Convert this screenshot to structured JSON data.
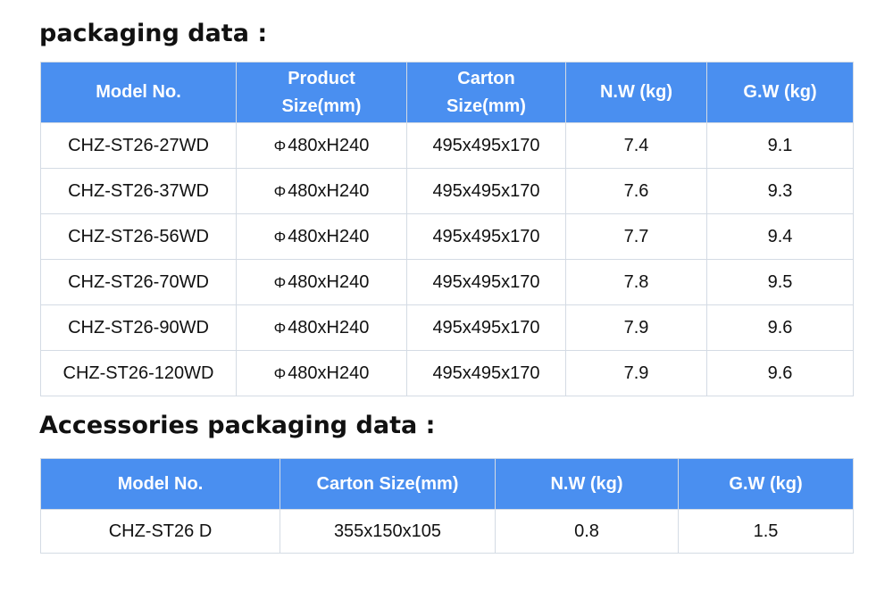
{
  "section1": {
    "title": "packaging data :",
    "headers": [
      {
        "line1": "Model No.",
        "line2": ""
      },
      {
        "line1": "Product",
        "line2": "Size(mm)"
      },
      {
        "line1": "Carton",
        "line2": "Size(mm)"
      },
      {
        "line1": "N.W (kg)",
        "line2": ""
      },
      {
        "line1": "G.W (kg)",
        "line2": ""
      }
    ],
    "rows": [
      {
        "model": "CHZ-ST26-27WD",
        "phi": "Φ",
        "size": "480xH240",
        "carton": "495x495x170",
        "nw": "7.4",
        "gw": "9.1"
      },
      {
        "model": "CHZ-ST26-37WD",
        "phi": "Φ",
        "size": "480xH240",
        "carton": "495x495x170",
        "nw": "7.6",
        "gw": "9.3"
      },
      {
        "model": "CHZ-ST26-56WD",
        "phi": "Φ",
        "size": "480xH240",
        "carton": "495x495x170",
        "nw": "7.7",
        "gw": "9.4"
      },
      {
        "model": "CHZ-ST26-70WD",
        "phi": "Φ",
        "size": "480xH240",
        "carton": "495x495x170",
        "nw": "7.8",
        "gw": "9.5"
      },
      {
        "model": "CHZ-ST26-90WD",
        "phi": "Φ",
        "size": "480xH240",
        "carton": "495x495x170",
        "nw": "7.9",
        "gw": "9.6"
      },
      {
        "model": "CHZ-ST26-120WD",
        "phi": "Φ",
        "size": "480xH240",
        "carton": "495x495x170",
        "nw": "7.9",
        "gw": "9.6"
      }
    ]
  },
  "section2": {
    "title": "Accessories packaging data :",
    "headers": [
      "Model No.",
      "Carton Size(mm)",
      "N.W (kg)",
      "G.W (kg)"
    ],
    "rows": [
      {
        "model": "CHZ-ST26 D",
        "carton": "355x150x105",
        "nw": "0.8",
        "gw": "1.5"
      }
    ]
  },
  "colors": {
    "header_bg": "#4a8ff0",
    "header_text": "#ffffff",
    "border": "#d4dbe4"
  }
}
